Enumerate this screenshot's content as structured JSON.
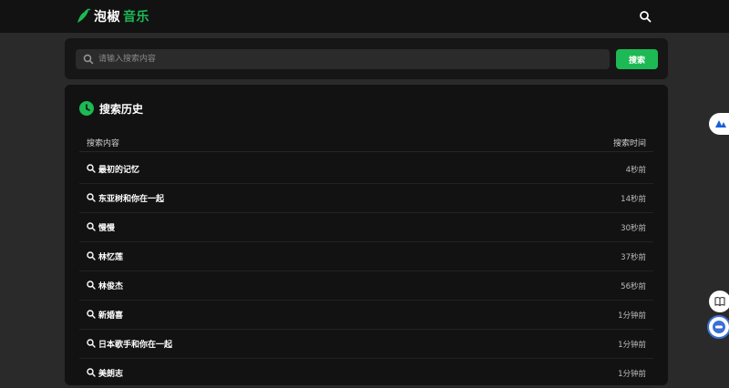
{
  "app": {
    "logo_a": "泡椒",
    "logo_b": "音乐"
  },
  "search": {
    "placeholder": "请输入搜索内容",
    "button_label": "搜索"
  },
  "history": {
    "title": "搜索历史",
    "col_content": "搜索内容",
    "col_time": "搜索时间",
    "rows": [
      {
        "text": "最初的记忆",
        "time": "4秒前"
      },
      {
        "text": "东亚树和你在一起",
        "time": "14秒前"
      },
      {
        "text": "慢慢",
        "time": "30秒前"
      },
      {
        "text": "林忆莲",
        "time": "37秒前"
      },
      {
        "text": "林俊杰",
        "time": "56秒前"
      },
      {
        "text": "新婚喜",
        "time": "1分钟前"
      },
      {
        "text": "日本歌手和你在一起",
        "time": "1分钟前"
      },
      {
        "text": "美朗志",
        "time": "1分钟前"
      }
    ]
  },
  "colors": {
    "accent": "#1db954",
    "background": "#2a2a2a",
    "card": "#121212"
  }
}
